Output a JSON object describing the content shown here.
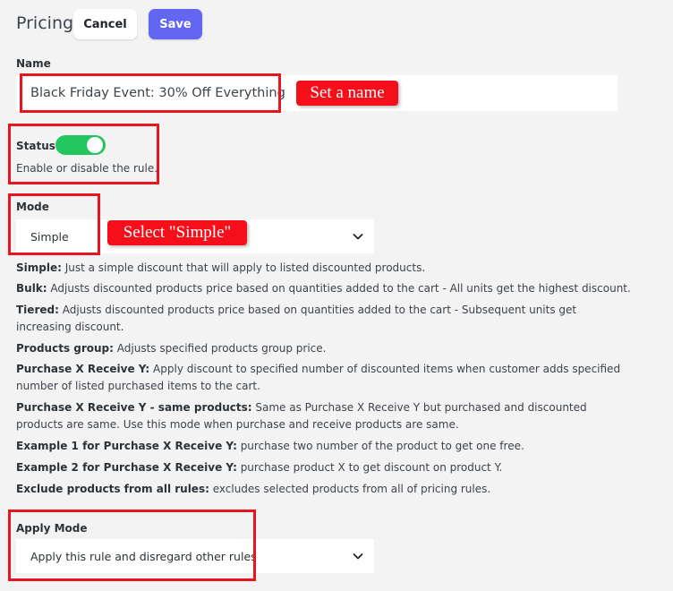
{
  "header": {
    "title": "Pricing",
    "cancel_label": "Cancel",
    "save_label": "Save"
  },
  "name": {
    "label": "Name",
    "value": "Black Friday Event: 30% Off Everything"
  },
  "status": {
    "label": "Status",
    "enabled": true,
    "help": "Enable or disable the rule."
  },
  "mode": {
    "label": "Mode",
    "selected": "Simple"
  },
  "descriptions": [
    {
      "term": "Simple:",
      "text": " Just a simple discount that will apply to listed discounted products."
    },
    {
      "term": "Bulk:",
      "text": " Adjusts discounted products price based on quantities added to the cart - All units get the highest discount."
    },
    {
      "term": "Tiered:",
      "text": " Adjusts discounted products price based on quantities added to the cart - Subsequent units get increasing discount."
    },
    {
      "term": "Products group:",
      "text": " Adjusts specified products group price."
    },
    {
      "term": "Purchase X Receive Y:",
      "text": " Apply discount to specified number of discounted items when customer adds specified number of listed purchased items to the cart."
    },
    {
      "term": "Purchase X Receive Y - same products:",
      "text": " Same as Purchase X Receive Y but purchased and discounted products are same. Use this mode when purchase and receive products are same."
    },
    {
      "term": "Example 1 for Purchase X Receive Y:",
      "text": " purchase two number of the product to get one free."
    },
    {
      "term": "Example 2 for Purchase X Receive Y:",
      "text": " purchase product X to get discount on product Y."
    },
    {
      "term": "Exclude products from all rules:",
      "text": " excludes selected products from all of pricing rules."
    }
  ],
  "apply_mode": {
    "label": "Apply Mode",
    "selected": "Apply this rule and disregard other rules"
  },
  "annotations": {
    "name_callout": "Set a name",
    "mode_callout": "Select \"Simple\"",
    "color": "#e8141f"
  },
  "colors": {
    "accent": "#6366f1",
    "toggle_on": "#22c55e",
    "background": "#f3f3f4"
  }
}
